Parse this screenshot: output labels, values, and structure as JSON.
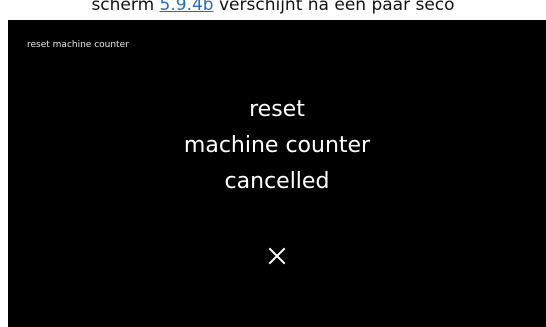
{
  "doc": {
    "caption_before": "scherm ",
    "caption_link": "5.9.4b",
    "caption_after": " verschijnt na een paar seco"
  },
  "screen": {
    "title": "reset machine counter",
    "message": {
      "line1": "reset",
      "line2": "machine counter",
      "line3": "cancelled"
    },
    "status_icon": "close-icon",
    "colors": {
      "background": "#000000",
      "text": "#ffffff",
      "link": "#2b6cb8"
    }
  }
}
